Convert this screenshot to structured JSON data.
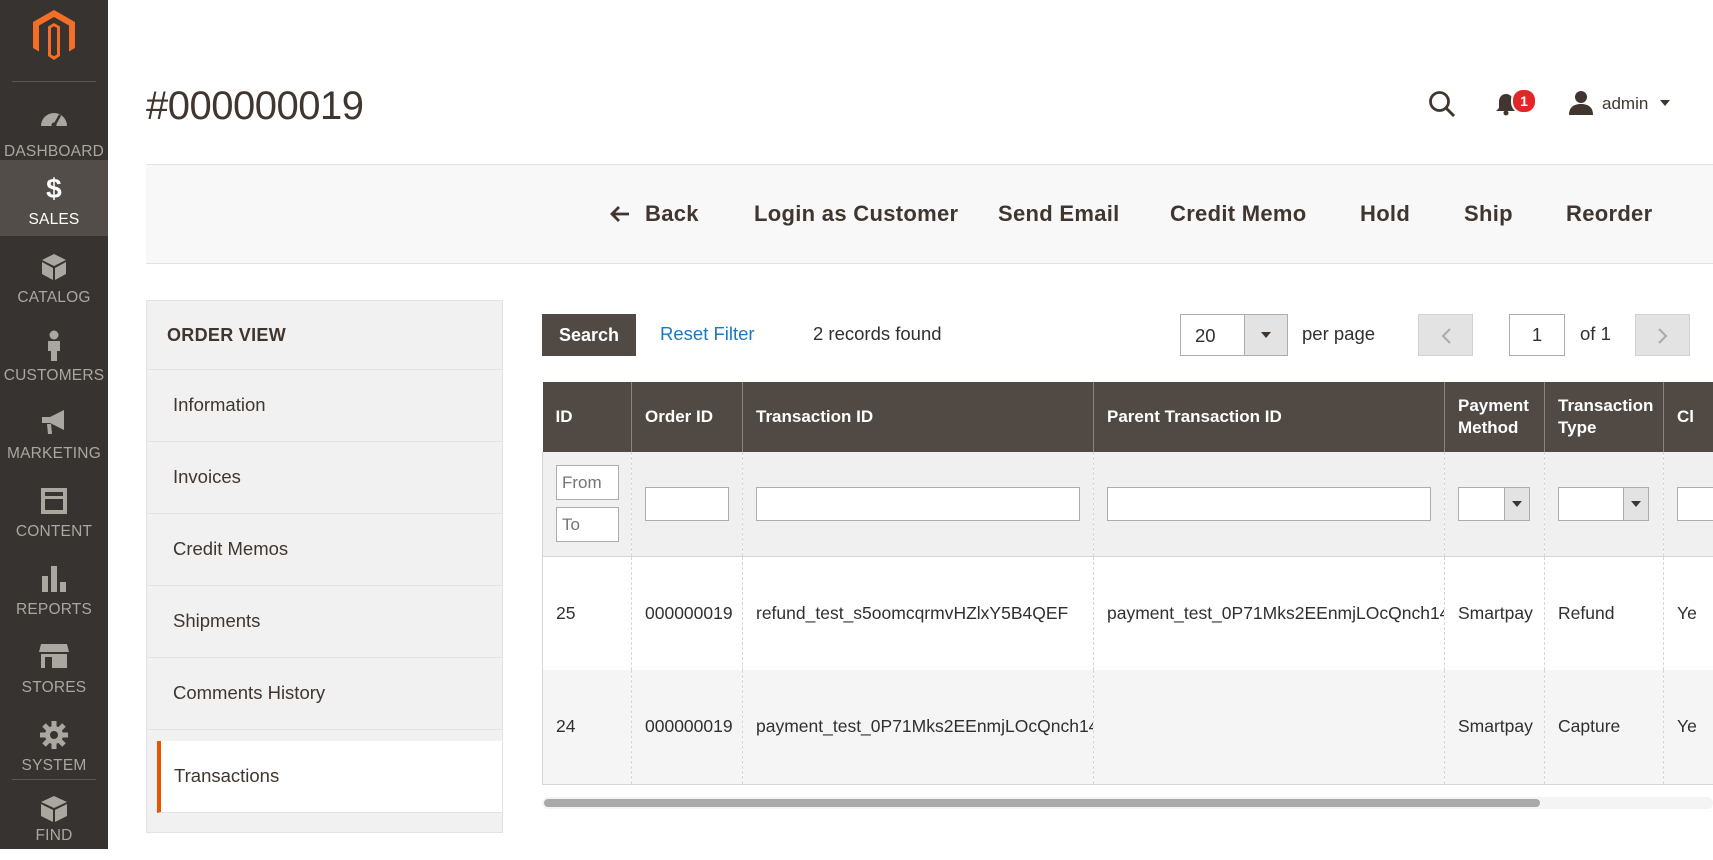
{
  "sidebar": {
    "logo": "magento-logo",
    "items": [
      {
        "label": "DASHBOARD",
        "icon": "dashboard-icon"
      },
      {
        "label": "SALES",
        "icon": "dollar-icon",
        "active": true
      },
      {
        "label": "CATALOG",
        "icon": "box-icon"
      },
      {
        "label": "CUSTOMERS",
        "icon": "person-icon"
      },
      {
        "label": "MARKETING",
        "icon": "megaphone-icon"
      },
      {
        "label": "CONTENT",
        "icon": "content-icon"
      },
      {
        "label": "REPORTS",
        "icon": "bar-chart-icon"
      },
      {
        "label": "STORES",
        "icon": "store-icon"
      },
      {
        "label": "SYSTEM",
        "icon": "gear-icon"
      },
      {
        "label": "FIND",
        "icon": "partners-box-icon"
      }
    ]
  },
  "header": {
    "title": "#000000019",
    "notification_count": "1",
    "username": "admin"
  },
  "toolbar": {
    "back": "Back",
    "login_as_customer": "Login as Customer",
    "send_email": "Send Email",
    "credit_memo": "Credit Memo",
    "hold": "Hold",
    "ship": "Ship",
    "reorder": "Reorder"
  },
  "order_view": {
    "title": "ORDER VIEW",
    "tabs": [
      {
        "label": "Information"
      },
      {
        "label": "Invoices"
      },
      {
        "label": "Credit Memos"
      },
      {
        "label": "Shipments"
      },
      {
        "label": "Comments History"
      },
      {
        "label": "Transactions",
        "active": true
      }
    ]
  },
  "grid": {
    "search_label": "Search",
    "reset_filter_label": "Reset Filter",
    "records_found": "2 records found",
    "per_page_value": "20",
    "per_page_label": "per page",
    "page_value": "1",
    "page_of": "of 1",
    "columns": [
      "ID",
      "Order ID",
      "Transaction ID",
      "Parent Transaction ID",
      "Payment Method",
      "Transaction Type",
      "Cl"
    ],
    "filter_placeholders": {
      "from": "From",
      "to": "To"
    },
    "rows": [
      {
        "id": "25",
        "order_id": "000000019",
        "transaction_id": "refund_test_s5oomcqrmvHZlxY5B4QEF",
        "parent_transaction_id": "payment_test_0P71Mks2EEnmjLOcQnch14",
        "payment_method": "Smartpay",
        "transaction_type": "Refund",
        "closed": "Ye"
      },
      {
        "id": "24",
        "order_id": "000000019",
        "transaction_id": "payment_test_0P71Mks2EEnmjLOcQnch14",
        "parent_transaction_id": "",
        "payment_method": "Smartpay",
        "transaction_type": "Capture",
        "closed": "Ye"
      }
    ]
  },
  "colors": {
    "sidebar_bg": "#373330",
    "sidebar_active": "#524d49",
    "accent": "#eb5202",
    "grid_header": "#514943",
    "link": "#1979c3",
    "badge": "#e22626"
  }
}
